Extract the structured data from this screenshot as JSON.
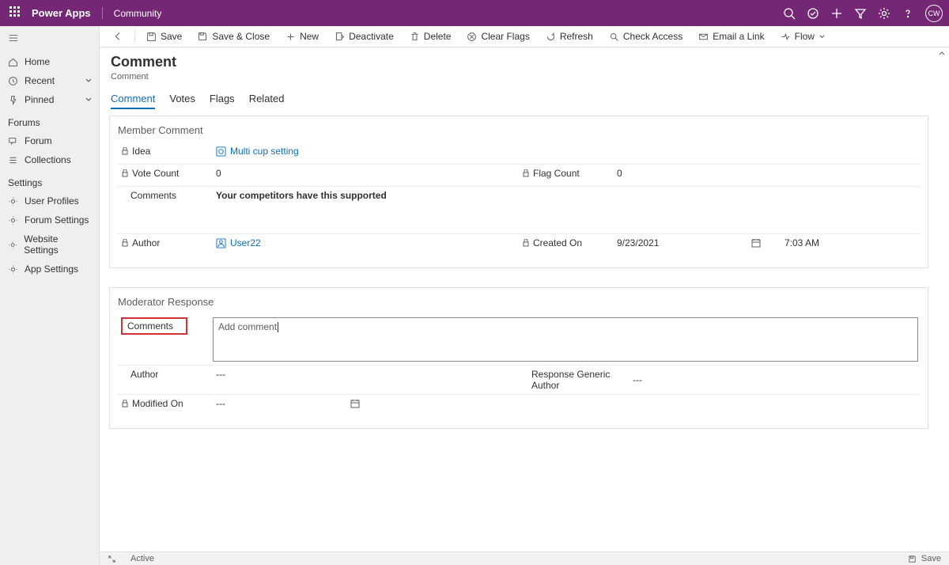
{
  "suite": {
    "brand": "Power Apps",
    "env": "Community",
    "avatar": "CW"
  },
  "nav": {
    "home": "Home",
    "recent": "Recent",
    "pinned": "Pinned",
    "forums_head": "Forums",
    "forum": "Forum",
    "collections": "Collections",
    "settings_head": "Settings",
    "user_profiles": "User Profiles",
    "forum_settings": "Forum Settings",
    "website_settings": "Website Settings",
    "app_settings": "App Settings"
  },
  "cmd": {
    "save": "Save",
    "save_close": "Save & Close",
    "new": "New",
    "deactivate": "Deactivate",
    "delete": "Delete",
    "clear_flags": "Clear Flags",
    "refresh": "Refresh",
    "check_access": "Check Access",
    "email_link": "Email a Link",
    "flow": "Flow"
  },
  "page": {
    "title": "Comment",
    "subtitle": "Comment"
  },
  "tabs": {
    "comment": "Comment",
    "votes": "Votes",
    "flags": "Flags",
    "related": "Related"
  },
  "member": {
    "section": "Member Comment",
    "idea_label": "Idea",
    "idea_value": "Multi cup setting",
    "vote_label": "Vote Count",
    "vote_value": "0",
    "flag_label": "Flag Count",
    "flag_value": "0",
    "comments_label": "Comments",
    "comments_value": "Your competitors have this supported",
    "author_label": "Author",
    "author_value": "User22",
    "created_label": "Created On",
    "created_date": "9/23/2021",
    "created_time": "7:03 AM"
  },
  "mod": {
    "section": "Moderator Response",
    "comments_label": "Comments",
    "comments_value": "Add comment",
    "author_label": "Author",
    "author_value": "---",
    "generic_label": "Response Generic Author",
    "generic_value": "---",
    "modified_label": "Modified On",
    "modified_value": "---"
  },
  "status": {
    "state": "Active",
    "save": "Save"
  }
}
